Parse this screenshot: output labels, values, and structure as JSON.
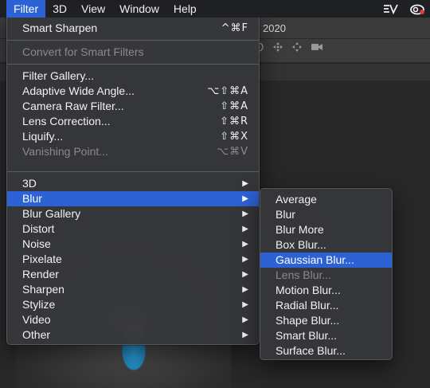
{
  "menubar": {
    "items": [
      "Filter",
      "3D",
      "View",
      "Window",
      "Help"
    ]
  },
  "background": {
    "doc_title_fragment": "2020"
  },
  "filter_menu": {
    "last_filter": {
      "label": "Smart Sharpen",
      "shortcut": "^⌘F"
    },
    "convert": {
      "label": "Convert for Smart Filters"
    },
    "group1": [
      {
        "label": "Filter Gallery...",
        "shortcut": ""
      },
      {
        "label": "Adaptive Wide Angle...",
        "shortcut": "⌥⇧⌘A"
      },
      {
        "label": "Camera Raw Filter...",
        "shortcut": "⇧⌘A"
      },
      {
        "label": "Lens Correction...",
        "shortcut": "⇧⌘R"
      },
      {
        "label": "Liquify...",
        "shortcut": "⇧⌘X"
      },
      {
        "label": "Vanishing Point...",
        "shortcut": "⌥⌘V"
      }
    ],
    "submenus": [
      "3D",
      "Blur",
      "Blur Gallery",
      "Distort",
      "Noise",
      "Pixelate",
      "Render",
      "Sharpen",
      "Stylize",
      "Video",
      "Other"
    ],
    "submenu_arrow": "▶"
  },
  "blur_menu": {
    "items": [
      "Average",
      "Blur",
      "Blur More",
      "Box Blur...",
      "Gaussian Blur...",
      "Lens Blur...",
      "Motion Blur...",
      "Radial Blur...",
      "Shape Blur...",
      "Smart Blur...",
      "Surface Blur..."
    ]
  },
  "colors": {
    "highlight": "#2c62d4",
    "menu_bg": "#36373a",
    "disabled_text": "#8a8a8d"
  }
}
